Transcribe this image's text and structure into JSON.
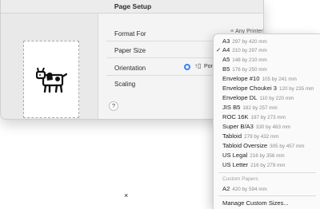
{
  "dialog": {
    "title": "Page Setup",
    "format_for_label": "Format For",
    "format_for_value": "Any Printer",
    "paper_size_label": "Paper Size",
    "orientation_label": "Orientation",
    "orientation_value": "Por",
    "scaling_label": "Scaling",
    "help_label": "?"
  },
  "menu": {
    "selected": "A4",
    "items": [
      {
        "name": "A3",
        "size": "297 by 420 mm"
      },
      {
        "name": "A4",
        "size": "210 by 297 mm"
      },
      {
        "name": "A5",
        "size": "148 by 210 mm"
      },
      {
        "name": "B5",
        "size": "176 by 250 mm"
      },
      {
        "name": "Envelope #10",
        "size": "105 by 241 mm"
      },
      {
        "name": "Envelope Choukei 3",
        "size": "120 by 235 mm"
      },
      {
        "name": "Envelope DL",
        "size": "110 by 220 mm"
      },
      {
        "name": "JIS B5",
        "size": "182 by 257 mm"
      },
      {
        "name": "ROC 16K",
        "size": "197 by 273 mm"
      },
      {
        "name": "Super B/A3",
        "size": "330 by 483 mm"
      },
      {
        "name": "Tabloid",
        "size": "279 by 432 mm"
      },
      {
        "name": "Tabloid Oversize",
        "size": "305 by 457 mm"
      },
      {
        "name": "US Legal",
        "size": "216 by 356 mm"
      },
      {
        "name": "US Letter",
        "size": "216 by 279 mm"
      }
    ],
    "custom_header": "Custom Papers",
    "custom_items": [
      {
        "name": "A2",
        "size": "420 by 594 mm"
      }
    ],
    "manage_label": "Manage Custom Sizes..."
  },
  "close_glyph": "×"
}
